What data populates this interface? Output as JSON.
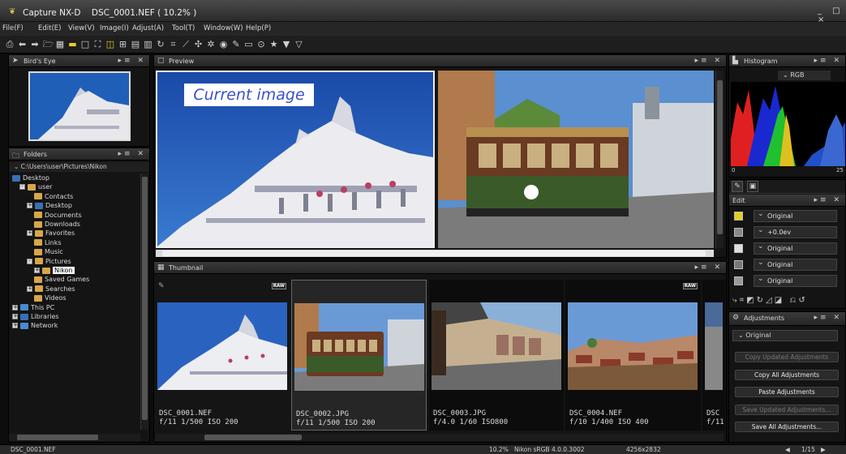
{
  "window": {
    "app_name": "Capture NX-D",
    "doc_title": "DSC_0001.NEF ( 10.2% )",
    "controls": "_ □ ×"
  },
  "menu": [
    "File(F)",
    "Edit(E)",
    "View(V)",
    "Image(I)",
    "Adjust(A)",
    "Tool(T)",
    "Window(W)",
    "Help(P)"
  ],
  "toolbar_icons": [
    "print-icon",
    "back-icon",
    "forward-icon",
    "folder-open-icon",
    "grid-icon",
    "filmstrip-icon",
    "single-view-icon",
    "fullscreen-icon",
    "compare-icon",
    "multi-compare-icon",
    "layout-icon",
    "layout-alt-icon",
    "rotate-icon",
    "crop-icon",
    "straighten-icon",
    "dust-icon",
    "retouch-icon",
    "red-eye-icon",
    "color-picker-icon",
    "monitor-icon",
    "control-point-icon",
    "star-icon",
    "filter-icon",
    "filter-clear-icon"
  ],
  "birds_eye": {
    "title": "Bird's Eye"
  },
  "folders": {
    "title": "Folders",
    "path": "C:\\Users\\user\\Pictures\\Nikon",
    "tree": [
      {
        "label": "Desktop",
        "indent": 0,
        "exp": "",
        "kind": "blue"
      },
      {
        "label": "user",
        "indent": 1,
        "exp": "-",
        "kind": "folder"
      },
      {
        "label": "Contacts",
        "indent": 3,
        "exp": "",
        "kind": "folder"
      },
      {
        "label": "Desktop",
        "indent": 2,
        "exp": "+",
        "kind": "blue"
      },
      {
        "label": "Documents",
        "indent": 3,
        "exp": "",
        "kind": "folder"
      },
      {
        "label": "Downloads",
        "indent": 3,
        "exp": "",
        "kind": "folder"
      },
      {
        "label": "Favorites",
        "indent": 2,
        "exp": "+",
        "kind": "folder"
      },
      {
        "label": "Links",
        "indent": 3,
        "exp": "",
        "kind": "folder"
      },
      {
        "label": "Music",
        "indent": 3,
        "exp": "",
        "kind": "folder"
      },
      {
        "label": "Pictures",
        "indent": 2,
        "exp": "-",
        "kind": "folder"
      },
      {
        "label": "Nikon",
        "indent": 3,
        "exp": "+",
        "kind": "folder",
        "selected": true
      },
      {
        "label": "Saved Games",
        "indent": 3,
        "exp": "",
        "kind": "folder"
      },
      {
        "label": "Searches",
        "indent": 2,
        "exp": "+",
        "kind": "folder"
      },
      {
        "label": "Videos",
        "indent": 3,
        "exp": "",
        "kind": "folder"
      },
      {
        "label": "This PC",
        "indent": 0,
        "exp": "+",
        "kind": "pc"
      },
      {
        "label": "Libraries",
        "indent": 0,
        "exp": "+",
        "kind": "blue"
      },
      {
        "label": "Network",
        "indent": 0,
        "exp": "+",
        "kind": "pc"
      }
    ]
  },
  "preview": {
    "title": "Preview",
    "overlay_label": "Current image"
  },
  "thumbnail": {
    "title": "Thumbnail",
    "items": [
      {
        "name": "DSC_0001.NEF",
        "meta": "f/11 1/500 ISO 200",
        "raw": "RAW",
        "scene": "building"
      },
      {
        "name": "DSC_0002.JPG",
        "meta": "f/11 1/500 ISO 200",
        "raw": "",
        "scene": "tram"
      },
      {
        "name": "DSC_0003.JPG",
        "meta": "f/4.0 1/60 ISO800",
        "raw": "",
        "scene": "street"
      },
      {
        "name": "DSC_0004.NEF",
        "meta": "f/10 1/400 ISO 400",
        "raw": "RAW",
        "scene": "town"
      },
      {
        "name": "DSC",
        "meta": "f/11",
        "raw": "",
        "scene": "partial"
      }
    ]
  },
  "histogram": {
    "title": "Histogram",
    "channel": "RGB",
    "min_label": "0",
    "max_label": "25"
  },
  "edit": {
    "title": "Edit",
    "rows": [
      {
        "icon": "picture-control-icon",
        "value": "Original"
      },
      {
        "icon": "exposure-icon",
        "value": "+0.0ev"
      },
      {
        "icon": "white-balance-icon",
        "value": "Original"
      },
      {
        "icon": "tone-icon",
        "value": "Original"
      },
      {
        "icon": "color-icon",
        "value": "Original"
      }
    ]
  },
  "adjustments": {
    "title": "Adjustments",
    "selected": "Original",
    "buttons": [
      {
        "label": "Copy Updated Adjustments",
        "enabled": false
      },
      {
        "label": "Copy All Adjustments",
        "enabled": true
      },
      {
        "label": "Paste Adjustments",
        "enabled": true
      },
      {
        "label": "Save Updated Adjustments...",
        "enabled": false
      },
      {
        "label": "Save All Adjustments...",
        "enabled": true
      }
    ]
  },
  "status": {
    "file": "DSC_0001.NEF",
    "zoom": "10.2%",
    "profile": "Nikon sRGB 4.0.0.3002",
    "dimensions": "4256x2832",
    "page": "1/15"
  }
}
